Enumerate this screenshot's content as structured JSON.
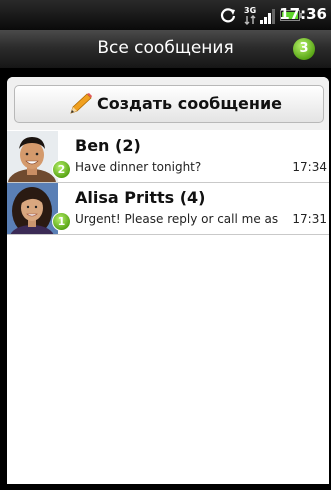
{
  "status_bar": {
    "time": "17:36",
    "network_label": "3G",
    "icons": [
      "sync-icon",
      "3g-network-icon",
      "signal-icon",
      "battery-icon"
    ]
  },
  "title_bar": {
    "title": "Все сообщения",
    "unread_count": "3"
  },
  "compose": {
    "label": "Создать сообщение",
    "icon": "pencil-icon"
  },
  "conversations": [
    {
      "name": "Ben (2)",
      "preview": "Have dinner tonight?",
      "time": "17:34",
      "unread": "2"
    },
    {
      "name": "Alisa Pritts (4)",
      "preview": "Urgent! Please reply or call me as soon as possible",
      "time": "17:31",
      "unread": "1"
    }
  ],
  "colors": {
    "badge_green": "#5aa617",
    "title_bar_top": "#4a4a4a",
    "title_bar_bottom": "#161616"
  }
}
